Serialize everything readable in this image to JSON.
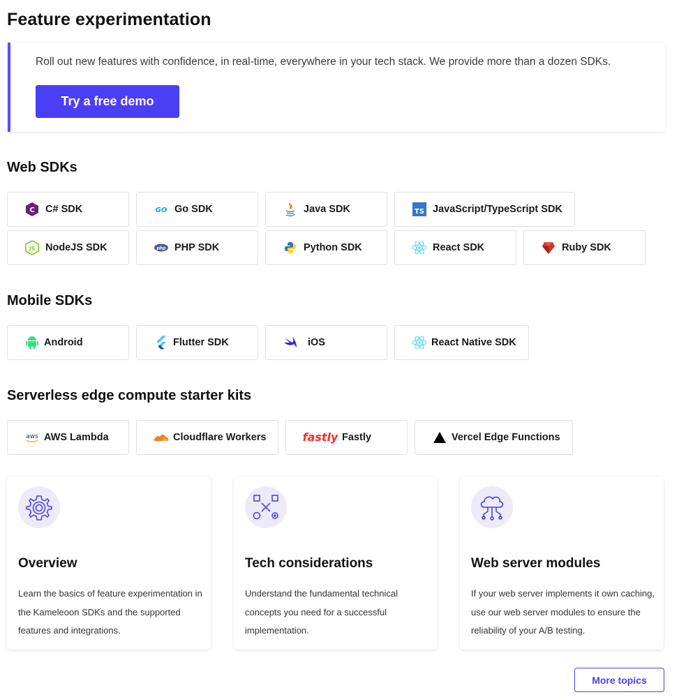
{
  "page": {
    "title": "Feature experimentation"
  },
  "hero": {
    "text": "Roll out new features with confidence, in real-time, everywhere in your tech stack. We provide more than a dozen SDKs.",
    "button_label": "Try a free demo"
  },
  "web_sdks": {
    "title": "Web SDKs",
    "items": [
      {
        "label": "C# SDK",
        "icon": "csharp-icon"
      },
      {
        "label": "Go SDK",
        "icon": "go-icon"
      },
      {
        "label": "Java SDK",
        "icon": "java-icon"
      },
      {
        "label": "JavaScript/TypeScript SDK",
        "icon": "typescript-icon"
      },
      {
        "label": "NodeJS SDK",
        "icon": "nodejs-icon"
      },
      {
        "label": "PHP SDK",
        "icon": "php-icon"
      },
      {
        "label": "Python SDK",
        "icon": "python-icon"
      },
      {
        "label": "React SDK",
        "icon": "react-icon"
      },
      {
        "label": "Ruby SDK",
        "icon": "ruby-icon"
      }
    ]
  },
  "mobile_sdks": {
    "title": "Mobile SDKs",
    "items": [
      {
        "label": "Android",
        "icon": "android-icon"
      },
      {
        "label": "Flutter SDK",
        "icon": "flutter-icon"
      },
      {
        "label": "iOS",
        "icon": "swift-icon"
      },
      {
        "label": "React Native SDK",
        "icon": "react-icon"
      }
    ]
  },
  "edge_kits": {
    "title": "Serverless edge compute starter kits",
    "items": [
      {
        "label": "AWS Lambda",
        "icon": "aws-icon",
        "logo_text": "aws"
      },
      {
        "label": "Cloudflare Workers",
        "icon": "cloudflare-icon"
      },
      {
        "label": "Fastly",
        "icon": "fastly-icon",
        "logo_text": "fastly"
      },
      {
        "label": "Vercel Edge Functions",
        "icon": "vercel-icon"
      }
    ]
  },
  "topics": [
    {
      "title": "Overview",
      "description": "Learn the basics of feature experimentation in the Kameleoon SDKs and the supported features and integrations.",
      "icon": "gear-icon"
    },
    {
      "title": "Tech considerations",
      "description": "Understand the fundamental technical concepts you need for a successful implementation.",
      "icon": "nodes-icon"
    },
    {
      "title": "Web server modules",
      "description": "If your web server implements it own caching, use our web server modules to ensure the reliability of your A/B testing.",
      "icon": "cloud-network-icon"
    }
  ],
  "more_topics": {
    "label": "More topics"
  },
  "colors": {
    "accent": "#4b3ff5",
    "hero_border": "#5b4bff",
    "icon_bg": "#ecebf7"
  }
}
